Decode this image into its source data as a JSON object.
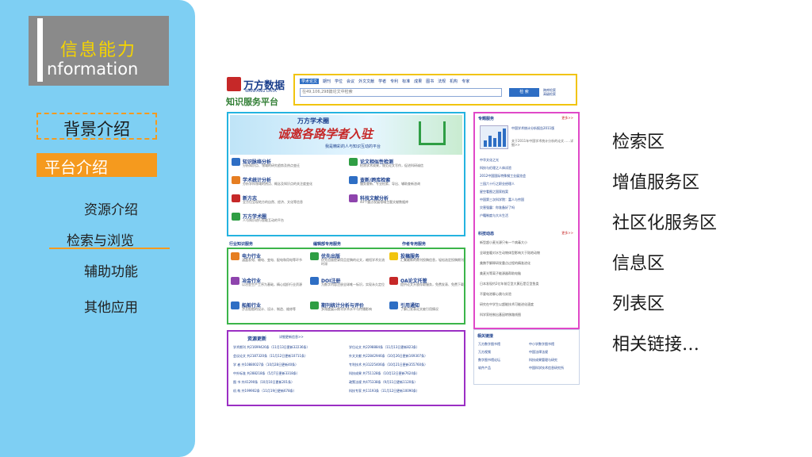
{
  "sidebar": {
    "title_cn": "信息能力",
    "title_big_letter": "I",
    "title_en": "nformation",
    "nav_section": "背景介绍",
    "nav_active": "平台介绍",
    "sub_items": [
      "资源介绍",
      "检索与浏览",
      "辅助功能",
      "其他应用"
    ]
  },
  "screenshot": {
    "logo": {
      "name": "万方数据",
      "en": "WANFANG DATA",
      "sub": "知识服务平台"
    },
    "menu": [
      "学术论文",
      "期刊",
      "学位",
      "会议",
      "外文文献",
      "学者",
      "专利",
      "标准",
      "成果",
      "图书",
      "法规",
      "机构",
      "专家"
    ],
    "search_placeholder": "在49,106,298篇论文中检索",
    "search_button": "检 索",
    "search_links": [
      "跨库检索",
      "高级检索"
    ],
    "banner": {
      "top": "万方学术圈",
      "title": "诚邀各路学者入驻",
      "sub": "我是精彩的人与知识互动的平台"
    },
    "services": [
      {
        "name": "知识脉络分析",
        "desc": "分析知识点、领域的研究趋势及热点变迁"
      },
      {
        "name": "论文相似性检测",
        "desc": "检测学术成果，规范论文写作，促进科研诚信"
      },
      {
        "name": "学术统计分析",
        "desc": "分析学科领域的热点、概念及知识点的关注度变化"
      },
      {
        "name": "查新/跨库检索",
        "desc": "服务查新、专业检索、导出、辅助查新咨询"
      },
      {
        "name": "新方志",
        "desc": "全方位呈现地方的自然、经济、文化等信息"
      },
      {
        "name": "科技文献分析",
        "desc": "40个重点发展领域主题文献数据库"
      },
      {
        "name": "万方学术圈",
        "desc": "人与知识进行智能互动的平台"
      }
    ],
    "area_heads": [
      "行业知识服务",
      "编辑部专用服务",
      "作者专用服务"
    ],
    "industry": [
      {
        "name": "电力行业",
        "desc": "涵盖发电、输电、变电、配电和用电等环节"
      },
      {
        "name": "优先出版",
        "desc": "优先出版经录用且定稿的论文，缩短学术交流时滞"
      },
      {
        "name": "投稿服务",
        "desc": "汇集最新的期刊投稿信息，轻松选定投稿期刊"
      },
      {
        "name": "冶金行业",
        "desc": "以冶金生产工序为基础，精心组织行业资源"
      },
      {
        "name": "DOI注册",
        "desc": "为数字内容注册全球唯一标识，实现永久定位"
      },
      {
        "name": "OA论文托管",
        "desc": "提供论文开放存取服务，免费发表、免费下载"
      },
      {
        "name": "船舶行业",
        "desc": "涉及船舶的设计、设计、制造、维修等"
      },
      {
        "name": "期刊统计分析与评价",
        "desc": "多角度展示期刊学术水平与传播影响"
      },
      {
        "name": "引用通知",
        "desc": "了解已发表论文被引用情况"
      }
    ],
    "resources_title": "资源更新",
    "resources_link": "详细更新信息>>",
    "resources_left": [
      "学术期刊  共21699426条（11月13日更新32236条）",
      "会议论文  共2187320条（11月12日更新10711条）",
      "学  者  共10880027条（10月28日更新40条）",
      "中外标准  共288218条（5月7日更新3318条）",
      "图  书  共41290条（10月10日更新201条）",
      "机  构  共199902条（11月19日更新678条）"
    ],
    "resources_right": [
      "学位论文  共2298884条（11月13日更新823条）",
      "外文文献  共22842946条（10月26日更新169307条）",
      "专利技术  共31225406条（10月21日更新355760条）",
      "科技成果  共751128条（10月12日更新7624条）",
      "政策法规  共475338条（9月11日更新1120条）",
      "科技专家  共11193条（11月12日更新10090条）"
    ],
    "topic_head": "专题服务",
    "more": "更多>>",
    "report_title": "中国学术统计分析报告2011版",
    "report_desc": "关于2011年中国学术统计分析的论文……详细>>",
    "topics": [
      "中华文化之光",
      "科技与伦理之人体试验",
      "2012中国国际特殊钢工业展览会",
      "三园六十行之职业经理人",
      "星空看图之国家档案",
      "中国第三次科学院：富人与穷国",
      "灾害强震：你准备好了吗",
      "户籍制度与大众生活"
    ],
    "dynamic_head": "科技动态",
    "dynamics": [
      "新型超小麦光源只有一个病毒大小",
      "全球变暖对水生动物体型影响大于陆地动物",
      "美携手解释研发重点过程的精准进化",
      "美麦光等离子能源器帮助电脑",
      "日本发现约2亿年前巨型大黄石是巨型鱼类",
      "不要电池聊心跳与实验",
      "研究在中学生以超能技术可能进化速度",
      "科学家绘制出基因转移路线图"
    ],
    "links_head": "相关链接",
    "links": [
      "万方数字图书馆",
      "中小学数字图书馆",
      "万方视频",
      "中国法律法规",
      "数字图书馆论坛",
      "科技成果管理与研究",
      "软件产品",
      "中国科学技术信息研究所"
    ]
  },
  "right_labels": [
    "检索区",
    "增值服务区",
    "社区化服务区",
    "信息区",
    "列表区",
    "相关链接…"
  ],
  "colors": {
    "sidebar": "#7ecff3",
    "accent": "#f59a1e",
    "yellow_frame": "#f1c40f",
    "cyan": "#24b3e0",
    "green": "#3bb54a",
    "purple": "#9b2fc4",
    "pink": "#e048c8"
  }
}
